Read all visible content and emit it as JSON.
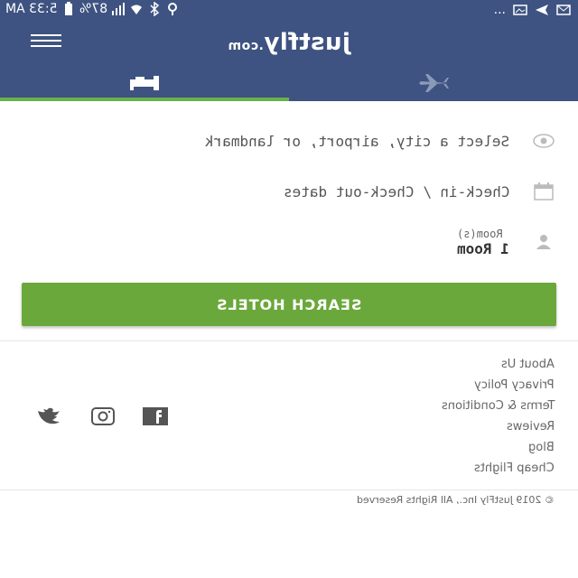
{
  "status_bar": {
    "time": "5:33 AM",
    "battery": "87%",
    "more": "..."
  },
  "app_bar": {
    "logo_main": "justfly",
    "logo_suffix": ".com",
    "menu_icon": "hamburger-menu-icon",
    "tabs": [
      {
        "label": "Hotels",
        "icon": "bed-icon",
        "active": true
      },
      {
        "label": "Flights",
        "icon": "airplane-icon",
        "active": false
      }
    ],
    "active_tab_color": "#6ab04c",
    "brand_color": "#3e5381"
  },
  "form": {
    "location_placeholder": "Select a city, airport, or landmark",
    "location_icon": "eye-icon",
    "dates_placeholder": "Check-in / Check-out dates",
    "dates_icon": "calendar-icon",
    "rooms_label": "Room(s)",
    "rooms_value": "1 Room",
    "rooms_icon": "person-icon",
    "search_button": "SEARCH HOTELS",
    "search_button_color": "#6aa83b"
  },
  "footer": {
    "links": [
      "About Us",
      "Privacy Policy",
      "Terms & Conditions",
      "Reviews",
      "Blog",
      "Cheap Flights"
    ],
    "social": [
      "facebook-icon",
      "instagram-icon",
      "twitter-icon"
    ],
    "copyright": "© 2019 JustFly Inc., All Rights Reserved"
  }
}
